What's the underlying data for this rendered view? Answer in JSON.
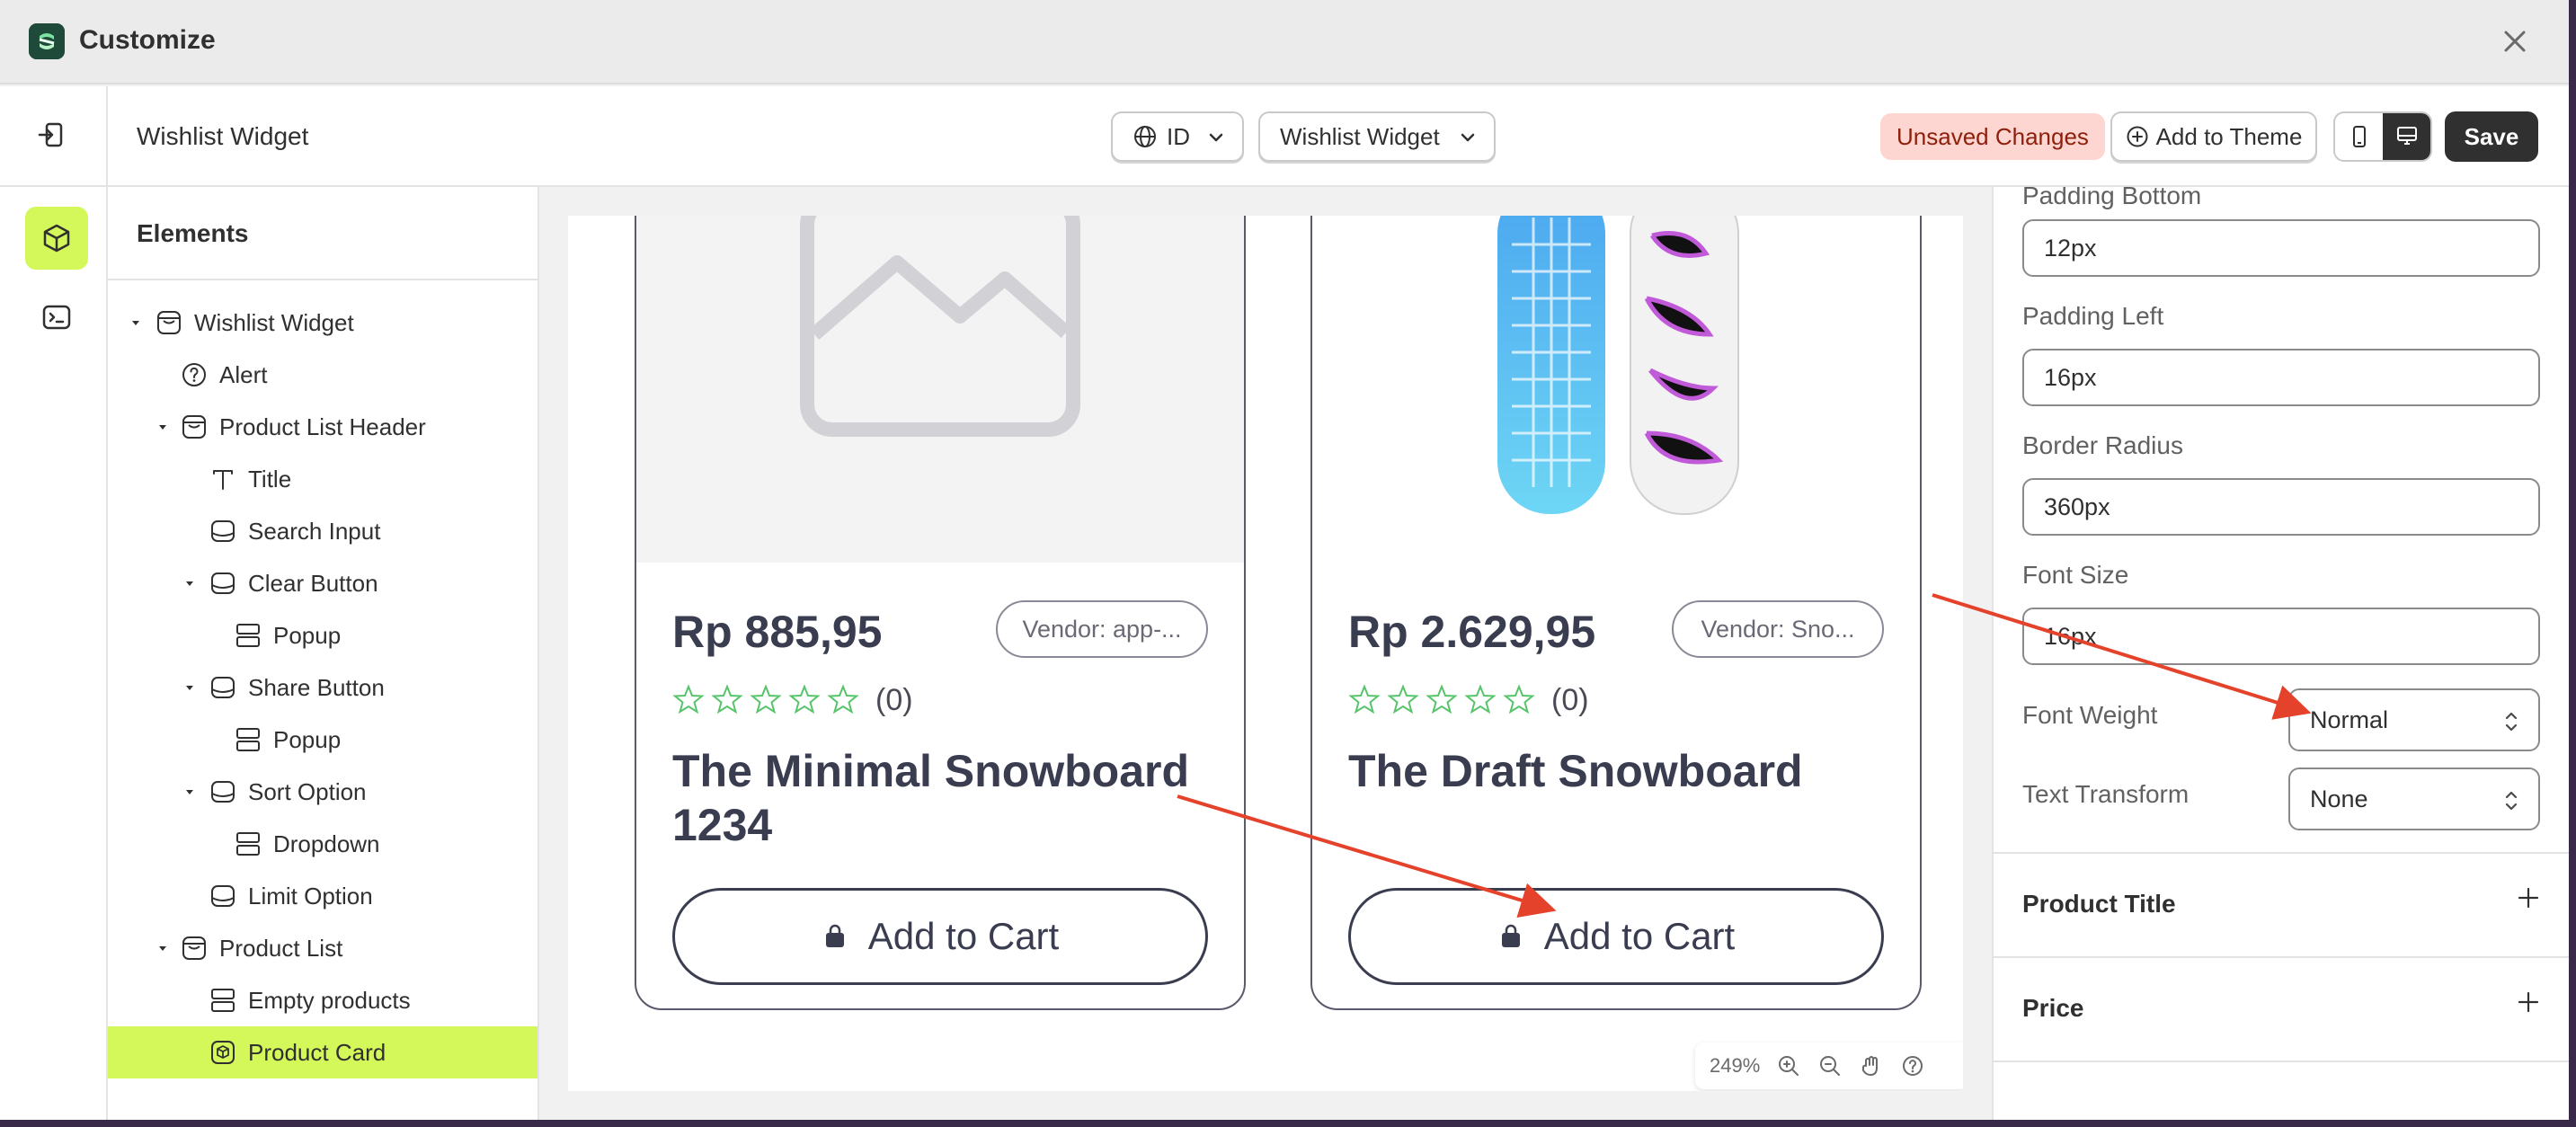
{
  "window": {
    "title": "Customize"
  },
  "toolbar": {
    "widget_name": "Wishlist Widget",
    "language": "ID",
    "widget_select": "Wishlist Widget",
    "unsaved": "Unsaved Changes",
    "add_to_theme": "Add to Theme",
    "save": "Save"
  },
  "elements": {
    "heading": "Elements",
    "tree": [
      {
        "label": "Wishlist Widget",
        "icon": "section-icon",
        "caret": true
      },
      {
        "label": "Alert",
        "icon": "help-circle-icon",
        "caret": false
      },
      {
        "label": "Product List Header",
        "icon": "section-icon",
        "caret": true
      },
      {
        "label": "Title",
        "icon": "text-icon",
        "caret": false
      },
      {
        "label": "Search Input",
        "icon": "block-icon",
        "caret": false
      },
      {
        "label": "Clear Button",
        "icon": "block-icon",
        "caret": true
      },
      {
        "label": "Popup",
        "icon": "layout-icon",
        "caret": false
      },
      {
        "label": "Share Button",
        "icon": "block-icon",
        "caret": true
      },
      {
        "label": "Popup",
        "icon": "layout-icon",
        "caret": false
      },
      {
        "label": "Sort Option",
        "icon": "block-icon",
        "caret": true
      },
      {
        "label": "Dropdown",
        "icon": "layout-icon",
        "caret": false
      },
      {
        "label": "Limit Option",
        "icon": "block-icon",
        "caret": false
      },
      {
        "label": "Product List",
        "icon": "section-icon",
        "caret": true
      },
      {
        "label": "Empty products",
        "icon": "layout-icon",
        "caret": false
      },
      {
        "label": "Product Card",
        "icon": "product-icon",
        "caret": false,
        "selected": true
      }
    ]
  },
  "products": [
    {
      "price": "Rp 885,95",
      "vendor": "Vendor: app-...",
      "reviews": "(0)",
      "title": "The Minimal Snowboard 1234",
      "button": "Add to Cart",
      "image": "placeholder-image-icon"
    },
    {
      "price": "Rp 2.629,95",
      "vendor": "Vendor: Sno...",
      "reviews": "(0)",
      "title": "The Draft Snowboard",
      "button": "Add to Cart",
      "image": "snowboard-image"
    }
  ],
  "zoom": {
    "level": "249%"
  },
  "settings": {
    "padding_bottom": {
      "label": "Padding Bottom",
      "value": "12px"
    },
    "padding_left": {
      "label": "Padding Left",
      "value": "16px"
    },
    "border_radius": {
      "label": "Border Radius",
      "value": "360px"
    },
    "font_size": {
      "label": "Font Size",
      "value": "16px"
    },
    "font_weight": {
      "label": "Font Weight",
      "value": "Normal"
    },
    "text_transform": {
      "label": "Text Transform",
      "value": "None"
    },
    "sections": [
      "Product Title",
      "Price"
    ]
  },
  "colors": {
    "accent": "#d4f75a",
    "primary_dark": "#303030",
    "unsaved_bg": "#fdd5d1",
    "unsaved_text": "#8e1f0b",
    "annotation_arrow": "#e5422b",
    "star": "#57c46b"
  }
}
